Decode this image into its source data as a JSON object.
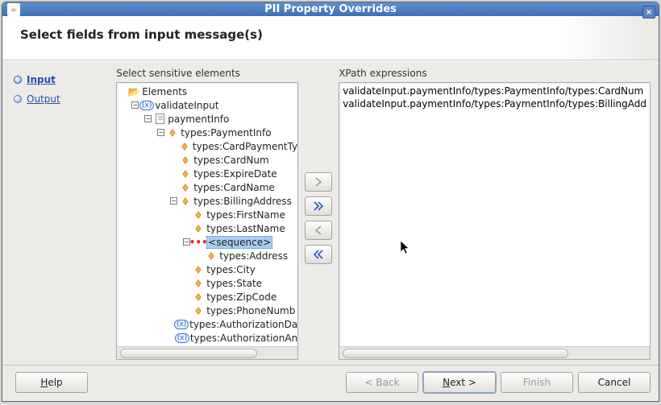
{
  "window": {
    "title": "PII Property Overrides",
    "close_label": "×"
  },
  "header": {
    "title": "Select fields from input message(s)"
  },
  "sidebar": {
    "items": [
      {
        "label": "Input",
        "active": true
      },
      {
        "label": "Output",
        "active": false
      }
    ]
  },
  "tree": {
    "header": "Select sensitive elements",
    "nodes": [
      {
        "depth": 0,
        "expander": null,
        "icon": "folder",
        "label": "Elements",
        "selected": false
      },
      {
        "depth": 1,
        "expander": "-",
        "icon": "var",
        "label": "validateInput",
        "selected": false
      },
      {
        "depth": 2,
        "expander": "-",
        "icon": "doc",
        "label": "paymentInfo",
        "selected": false
      },
      {
        "depth": 3,
        "expander": "-",
        "icon": "elem",
        "label": "types:PaymentInfo",
        "selected": false
      },
      {
        "depth": 4,
        "expander": null,
        "icon": "elem",
        "label": "types:CardPaymentTy",
        "selected": false
      },
      {
        "depth": 4,
        "expander": null,
        "icon": "elem",
        "label": "types:CardNum",
        "selected": false
      },
      {
        "depth": 4,
        "expander": null,
        "icon": "elem",
        "label": "types:ExpireDate",
        "selected": false
      },
      {
        "depth": 4,
        "expander": null,
        "icon": "elem",
        "label": "types:CardName",
        "selected": false
      },
      {
        "depth": 4,
        "expander": "-",
        "icon": "elem",
        "label": "types:BillingAddress",
        "selected": false
      },
      {
        "depth": 5,
        "expander": null,
        "icon": "elem",
        "label": "types:FirstName",
        "selected": false
      },
      {
        "depth": 5,
        "expander": null,
        "icon": "elem",
        "label": "types:LastName",
        "selected": false
      },
      {
        "depth": 5,
        "expander": "-",
        "icon": "seq",
        "label": "<sequence>",
        "selected": true
      },
      {
        "depth": 6,
        "expander": null,
        "icon": "elem",
        "label": "types:Address",
        "selected": false
      },
      {
        "depth": 5,
        "expander": null,
        "icon": "elem",
        "label": "types:City",
        "selected": false
      },
      {
        "depth": 5,
        "expander": null,
        "icon": "elem",
        "label": "types:State",
        "selected": false
      },
      {
        "depth": 5,
        "expander": null,
        "icon": "elem",
        "label": "types:ZipCode",
        "selected": false
      },
      {
        "depth": 5,
        "expander": null,
        "icon": "elem",
        "label": "types:PhoneNumb",
        "selected": false
      },
      {
        "depth": 4,
        "expander": null,
        "icon": "var",
        "label": "types:AuthorizationDa",
        "selected": false
      },
      {
        "depth": 4,
        "expander": null,
        "icon": "var",
        "label": "types:AuthorizationAn",
        "selected": false
      }
    ]
  },
  "buttons": {
    "add": ">",
    "addall": ">>",
    "remove": "<",
    "removeall": "<<"
  },
  "xpath": {
    "header": "XPath expressions",
    "items": [
      "validateInput.paymentInfo/types:PaymentInfo/types:CardNum",
      "validateInput.paymentInfo/types:PaymentInfo/types:BillingAdd"
    ]
  },
  "footer": {
    "help": "Help",
    "back": "< Back",
    "next": "Next >",
    "finish": "Finish",
    "cancel": "Cancel"
  }
}
